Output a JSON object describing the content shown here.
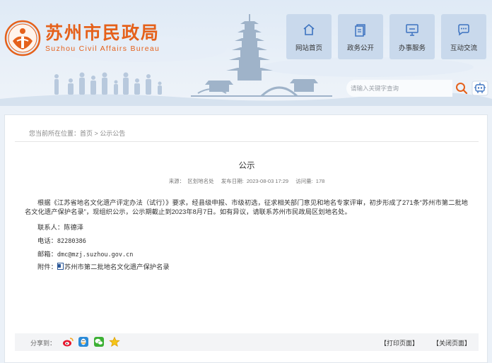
{
  "header": {
    "site_name_cn": "苏州市民政局",
    "site_name_en": "Suzhou Civil Affairs Bureau",
    "brand_color": "#e5611b",
    "nav": [
      {
        "label": "网站首页",
        "icon": "home-icon"
      },
      {
        "label": "政务公开",
        "icon": "document-icon"
      },
      {
        "label": "办事服务",
        "icon": "monitor-icon"
      },
      {
        "label": "互动交流",
        "icon": "chat-icon"
      }
    ],
    "search": {
      "placeholder": "请输入关键字查询"
    }
  },
  "breadcrumb": {
    "prefix": "您当前所在位置：",
    "items": [
      "首页",
      "公示公告"
    ],
    "separator": " > "
  },
  "article": {
    "title": "公示",
    "source_label": "来源：",
    "source": "区划地名处",
    "date_label": "发布日期:",
    "date": "2023-08-03 17:29",
    "views_label": "访问量:",
    "views": "178",
    "body": "根据《江苏省地名文化遗产评定办法（试行）》要求，经县级申报、市级初选，征求相关部门意见和地名专家评审，初步形成了271条“苏州市第二批地名文化遗产保护名录”，现组织公示，公示期截止到2023年8月7日。如有异议，请联系苏州市民政局区划地名处。",
    "contact_label": "联系人：",
    "contact": "陈德泽",
    "phone_label": "电话：",
    "phone": "82280386",
    "email_label": "邮箱：",
    "email": "dmc@mzj.suzhou.gov.cn",
    "attachment_label": "附件：",
    "attachment": "苏州市第二批地名文化遗产保护名录"
  },
  "footer_bar": {
    "share_label": "分享到：",
    "share_icons": [
      "weibo-icon",
      "qq-icon",
      "wechat-icon",
      "favorite-star-icon"
    ],
    "print_label": "【打印页面】",
    "close_label": "【关闭页面】"
  }
}
